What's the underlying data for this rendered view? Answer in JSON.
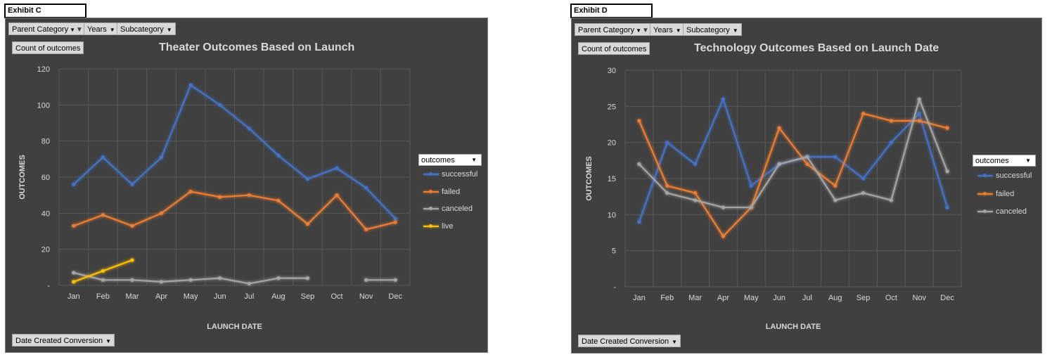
{
  "exhibits": [
    {
      "label": "Exhibit C",
      "filters": {
        "parent_category": "Parent Category",
        "years": "Years",
        "subcategory": "Subcategory"
      },
      "count_button": "Count of outcomes",
      "date_button": "Date Created Conversion",
      "legend_title": "outcomes",
      "chart_data": {
        "type": "line",
        "title": "Theater Outcomes Based on Launch",
        "xlabel": "LAUNCH DATE",
        "ylabel": "OUTCOMES",
        "categories": [
          "Jan",
          "Feb",
          "Mar",
          "Apr",
          "May",
          "Jun",
          "Jul",
          "Aug",
          "Sep",
          "Oct",
          "Nov",
          "Dec"
        ],
        "ylim": [
          0,
          120
        ],
        "yticks": [
          "-",
          "20",
          "40",
          "60",
          "80",
          "100",
          "120"
        ],
        "grid": true,
        "legend": "right",
        "series": [
          {
            "name": "successful",
            "color": "#4472c4",
            "values": [
              56,
              71,
              56,
              71,
              111,
              100,
              87,
              72,
              59,
              65,
              54,
              37
            ]
          },
          {
            "name": "failed",
            "color": "#ed7d31",
            "values": [
              33,
              39,
              33,
              40,
              52,
              49,
              50,
              47,
              34,
              50,
              31,
              35
            ]
          },
          {
            "name": "canceled",
            "color": "#a5a5a5",
            "values": [
              7,
              3,
              3,
              2,
              3,
              4,
              1,
              4,
              4,
              null,
              3,
              3
            ]
          },
          {
            "name": "live",
            "color": "#ffc000",
            "values": [
              2,
              8,
              14,
              null,
              null,
              null,
              null,
              null,
              null,
              null,
              null,
              null
            ]
          }
        ]
      }
    },
    {
      "label": "Exhibit D",
      "filters": {
        "parent_category": "Parent Category",
        "years": "Years",
        "subcategory": "Subcategory"
      },
      "count_button": "Count of outcomes",
      "date_button": "Date Created Conversion",
      "legend_title": "outcomes",
      "chart_data": {
        "type": "line",
        "title": "Technology Outcomes Based on Launch Date",
        "xlabel": "LAUNCH DATE",
        "ylabel": "OUTCOMES",
        "categories": [
          "Jan",
          "Feb",
          "Mar",
          "Apr",
          "May",
          "Jun",
          "Jul",
          "Aug",
          "Sep",
          "Oct",
          "Nov",
          "Dec"
        ],
        "ylim": [
          0,
          30
        ],
        "yticks": [
          "-",
          "5",
          "10",
          "15",
          "20",
          "25",
          "30"
        ],
        "grid": true,
        "legend": "right",
        "series": [
          {
            "name": "successful",
            "color": "#4472c4",
            "values": [
              9,
              20,
              17,
              26,
              14,
              17,
              18,
              18,
              15,
              20,
              24,
              11
            ]
          },
          {
            "name": "failed",
            "color": "#ed7d31",
            "values": [
              23,
              14,
              13,
              7,
              11,
              22,
              17,
              14,
              24,
              23,
              23,
              22
            ]
          },
          {
            "name": "canceled",
            "color": "#a5a5a5",
            "values": [
              17,
              13,
              12,
              11,
              11,
              17,
              18,
              12,
              13,
              12,
              26,
              16
            ]
          }
        ]
      }
    }
  ]
}
